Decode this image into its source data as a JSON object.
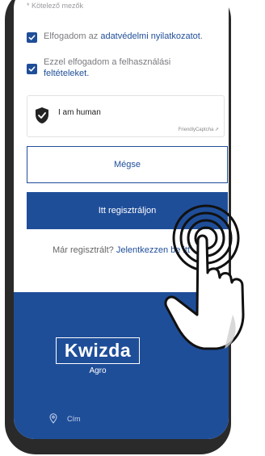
{
  "form": {
    "required_note": "* Kötelező mezők",
    "privacy": {
      "prefix": "Elfogadom az ",
      "link": "adatvédelmi nyilatkozatot",
      "suffix": "."
    },
    "terms": {
      "prefix": "Ezzel elfogadom a felhasználási",
      "link": "feltételeket",
      "suffix": "."
    },
    "captcha": {
      "label": "I am human",
      "brand": "FriendlyCaptcha ⇗"
    },
    "cancel_label": "Mégse",
    "register_label": "Itt regisztráljon",
    "login": {
      "prefix": "Már regisztrált? ",
      "link": "Jelentkezzen be itt"
    }
  },
  "footer": {
    "logo": "Kwizda",
    "logo_sub": "Agro",
    "address_label": "Cím"
  },
  "colors": {
    "accent": "#1f4e99",
    "frame": "#2a2a2a"
  }
}
